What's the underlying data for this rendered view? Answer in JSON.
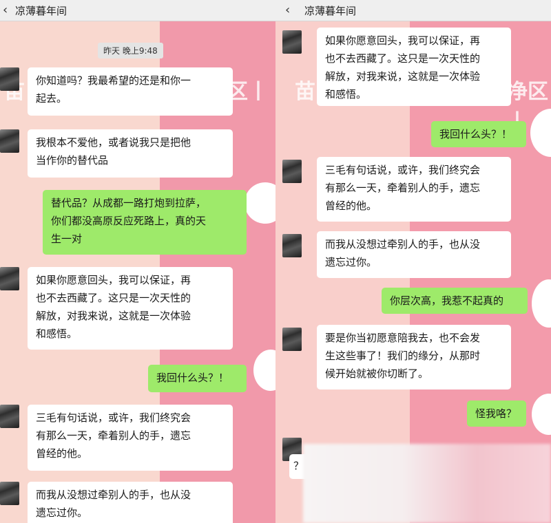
{
  "left": {
    "header": {
      "back_icon": "‹",
      "title": "凉薄暮年间"
    },
    "timestamp": "昨天 晚上9:48",
    "watermark_left": "苗",
    "watermark_right": "净区丨",
    "messages": [
      {
        "side": "in",
        "text": "你知道吗？我最希望的还是和你一\n起去。"
      },
      {
        "side": "in",
        "text": "我根本不爱他，或者说我只是把他\n当作你的替代品"
      },
      {
        "side": "out",
        "text": "替代品？从成都一路打炮到拉萨，\n你们都没高原反应死路上，真的天\n生一对"
      },
      {
        "side": "in",
        "text": "如果你愿意回头，我可以保证，再\n也不去西藏了。这只是一次天性的\n解放，对我来说，这就是一次体验\n和感悟。"
      },
      {
        "side": "out",
        "text": "我回什么头？！"
      },
      {
        "side": "in",
        "text": "三毛有句话说，或许，我们终究会\n有那么一天，牵着别人的手，遗忘\n曾经的他。"
      },
      {
        "side": "in",
        "text": "而我从没想过牵别人的手，也从没\n遗忘过你。"
      }
    ]
  },
  "right": {
    "header": {
      "dots": "··",
      "back_icon": "‹",
      "title": "凉薄暮年间"
    },
    "watermark_left": "苗",
    "watermark_right": "净区丨",
    "messages": [
      {
        "side": "in",
        "text": "如果你愿意回头，我可以保证，再\n也不去西藏了。这只是一次天性的\n解放，对我来说，这就是一次体验\n和感悟。"
      },
      {
        "side": "out",
        "text": "我回什么头？！"
      },
      {
        "side": "in",
        "text": "三毛有句话说，或许，我们终究会\n有那么一天，牵着别人的手，遗忘\n曾经的他。"
      },
      {
        "side": "in",
        "text": "而我从没想过牵别人的手，也从没\n遗忘过你。"
      },
      {
        "side": "out",
        "text": "你层次高，我惹不起真的"
      },
      {
        "side": "in",
        "text": "要是你当初愿意陪我去，也不会发\n生这些事了！我们的缘分，从那时\n候开始就被你切断了。"
      },
      {
        "side": "out",
        "text": "怪我咯？"
      },
      {
        "side": "in",
        "text": "？"
      }
    ]
  },
  "colors": {
    "bubble_out": "#9eea6a",
    "bubble_in": "#ffffff",
    "bg_pink": "#f199aa",
    "bg_peach": "#f9d8cf"
  }
}
